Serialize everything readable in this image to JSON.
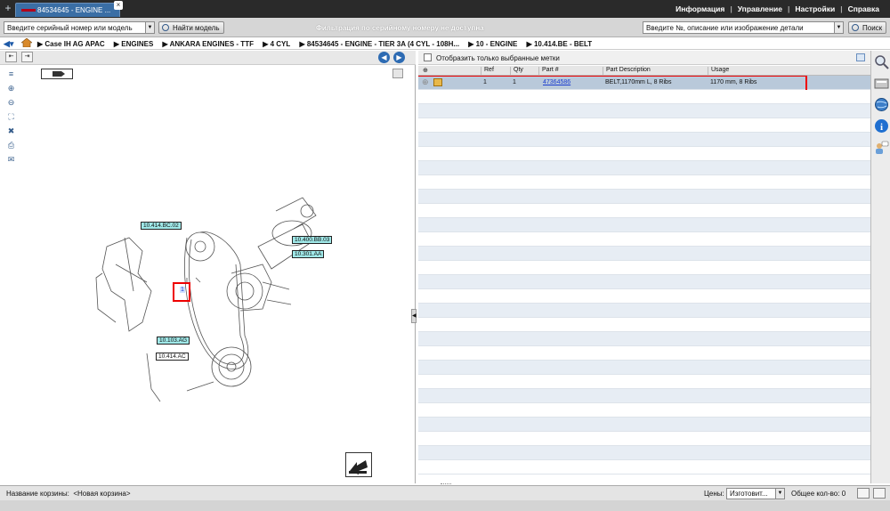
{
  "tab": {
    "label": "84534645 - ENGINE ...",
    "close": "×"
  },
  "top_menu": [
    "Информация",
    "Управление",
    "Настройки",
    "Справка"
  ],
  "search": {
    "serial_placeholder": "Введите серийный номер или модель",
    "find_model_label": "Найти модель",
    "filter_message": "Фильтрация по серийному номеру не доступна",
    "part_search_placeholder": "Введите №, описание или изображение детали",
    "search_label": "Поиск"
  },
  "breadcrumbs": [
    "Case IH AG APAC",
    "ENGINES",
    "ANKARA ENGINES - TTF",
    "4 CYL",
    "84534645 - ENGINE - TIER 3A (4 CYL - 108H...",
    "10 - ENGINE",
    "10.414.BE - BELT"
  ],
  "diagram": {
    "callouts": [
      "10.414.BC.02",
      "10.400.BB.03",
      "10.301.AA",
      "10.103.AG",
      "10.414.AC"
    ],
    "hotspot_label": "1"
  },
  "parts": {
    "show_selected_label": "Отобразить только выбранные метки",
    "columns": [
      "Ref",
      "Qty",
      "Part #",
      "Part Description",
      "Usage"
    ],
    "rows": [
      {
        "ref": "1",
        "qty": "1",
        "part": "47364586",
        "description": "BELT,1170mm L, 8 Ribs",
        "usage": "1170 mm, 8 Ribs"
      }
    ]
  },
  "status": {
    "basket_label": "Название корзины:",
    "basket_name": "<Новая корзина>",
    "prices_label": "Цены:",
    "prices_value": "Изготовит...",
    "total_label": "Общее кол-во:",
    "total_value": "0"
  },
  "colors": {
    "tab_blue": "#3a6ea5",
    "highlight_red": "#e00000",
    "callout_cyan": "#9fe8e8",
    "selected_row": "#b9c9da"
  }
}
